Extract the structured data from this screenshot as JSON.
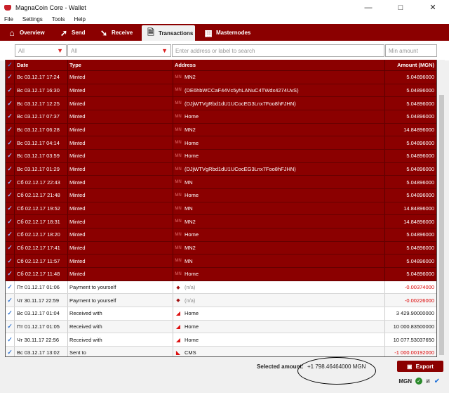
{
  "window": {
    "title": "MagnaCoin Core - Wallet"
  },
  "menu": [
    "File",
    "Settings",
    "Tools",
    "Help"
  ],
  "tabs": [
    {
      "label": "Overview",
      "icon": "home-icon",
      "active": false
    },
    {
      "label": "Send",
      "icon": "send-arrow-icon",
      "active": false
    },
    {
      "label": "Receive",
      "icon": "receive-arrow-icon",
      "active": false
    },
    {
      "label": "Transactions",
      "icon": "transactions-icon",
      "active": true
    },
    {
      "label": "Masternodes",
      "icon": "masternodes-icon",
      "active": false
    }
  ],
  "filters": {
    "date": "All",
    "type": "All",
    "address_placeholder": "Enter address or label to search",
    "min_amount_placeholder": "Min amount"
  },
  "table": {
    "headers": {
      "date": "Date",
      "type": "Type",
      "address": "Address",
      "amount": "Amount (MGN)"
    },
    "rows": [
      {
        "date": "Вс 03.12.17 17:24",
        "type": "Minted",
        "address": "MN2",
        "amount": "5.04896000",
        "kind": "minted"
      },
      {
        "date": "Вс 03.12.17 16:30",
        "type": "Minted",
        "address": "(DE6hbWCCaF44Vc5yhLANuC4TWdx4274UvS)",
        "amount": "5.04896000",
        "kind": "minted"
      },
      {
        "date": "Вс 03.12.17 12:25",
        "type": "Minted",
        "address": "(DJjWTVgRbd1dU1UCocEG3Lnx7Foo8hFJHN)",
        "amount": "5.04896000",
        "kind": "minted"
      },
      {
        "date": "Вс 03.12.17 07:37",
        "type": "Minted",
        "address": "Home",
        "amount": "5.04896000",
        "kind": "minted"
      },
      {
        "date": "Вс 03.12.17 06:28",
        "type": "Minted",
        "address": "MN2",
        "amount": "14.84896000",
        "kind": "minted"
      },
      {
        "date": "Вс 03.12.17 04:14",
        "type": "Minted",
        "address": "Home",
        "amount": "5.04896000",
        "kind": "minted"
      },
      {
        "date": "Вс 03.12.17 03:59",
        "type": "Minted",
        "address": "Home",
        "amount": "5.04896000",
        "kind": "minted"
      },
      {
        "date": "Вс 03.12.17 01:29",
        "type": "Minted",
        "address": "(DJjWTVgRbd1dU1UCocEG3Lnx7Foo8hFJHN)",
        "amount": "5.04896000",
        "kind": "minted"
      },
      {
        "date": "Сб 02.12.17 22:43",
        "type": "Minted",
        "address": "MN",
        "amount": "5.04896000",
        "kind": "minted"
      },
      {
        "date": "Сб 02.12.17 21:48",
        "type": "Minted",
        "address": "Home",
        "amount": "5.04896000",
        "kind": "minted"
      },
      {
        "date": "Сб 02.12.17 19:52",
        "type": "Minted",
        "address": "MN",
        "amount": "14.84896000",
        "kind": "minted"
      },
      {
        "date": "Сб 02.12.17 18:31",
        "type": "Minted",
        "address": "MN2",
        "amount": "14.84896000",
        "kind": "minted"
      },
      {
        "date": "Сб 02.12.17 18:20",
        "type": "Minted",
        "address": "Home",
        "amount": "5.04896000",
        "kind": "minted"
      },
      {
        "date": "Сб 02.12.17 17:41",
        "type": "Minted",
        "address": "MN2",
        "amount": "5.04896000",
        "kind": "minted"
      },
      {
        "date": "Сб 02.12.17 11:57",
        "type": "Minted",
        "address": "MN",
        "amount": "5.04896000",
        "kind": "minted"
      },
      {
        "date": "Сб 02.12.17 11:48",
        "type": "Minted",
        "address": "Home",
        "amount": "5.04896000",
        "kind": "minted"
      },
      {
        "date": "Пт 01.12.17 01:06",
        "type": "Payment to yourself",
        "address": "(n/a)",
        "amount": "-0.00374000",
        "kind": "self"
      },
      {
        "date": "Чт 30.11.17 22:59",
        "type": "Payment to yourself",
        "address": "(n/a)",
        "amount": "-0.00226000",
        "kind": "self"
      },
      {
        "date": "Вс 03.12.17 01:04",
        "type": "Received with",
        "address": "Home",
        "amount": "3 429.90000000",
        "kind": "received"
      },
      {
        "date": "Пт 01.12.17 01:05",
        "type": "Received with",
        "address": "Home",
        "amount": "10 000.83500000",
        "kind": "received"
      },
      {
        "date": "Чт 30.11.17 22:56",
        "type": "Received with",
        "address": "Home",
        "amount": "10 077.53037650",
        "kind": "received"
      },
      {
        "date": "Вс 03.12.17 13:02",
        "type": "Sent to",
        "address": "CMS",
        "amount": "-1 000.00192000",
        "kind": "sent"
      }
    ]
  },
  "footer": {
    "selected_label": "Selected amount:",
    "selected_value": "+1 798.46464000 MGN",
    "export_label": "Export",
    "unit": "MGN"
  },
  "colors": {
    "accent": "#8b0000",
    "negative": "#dd0000",
    "check": "#3a7bd5"
  }
}
